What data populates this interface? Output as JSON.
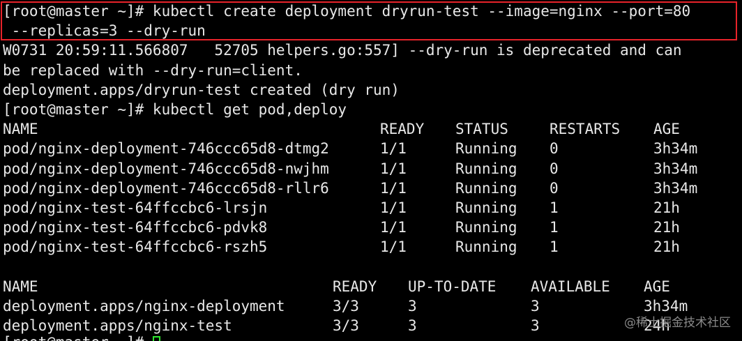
{
  "terminal": {
    "command_line_1": "[root@master ~]# kubectl create deployment dryrun-test --image=nginx --port=80",
    "command_line_2": " --replicas=3 --dry-run",
    "warning_line_1": "W0731 20:59:11.566807   52705 helpers.go:557] --dry-run is deprecated and can",
    "warning_line_2": "be replaced with --dry-run=client.",
    "created_line": "deployment.apps/dryrun-test created (dry run)",
    "get_command": "[root@master ~]# kubectl get pod,deploy",
    "pods_table": {
      "headers": [
        "NAME",
        "READY",
        "STATUS",
        "RESTARTS",
        "AGE"
      ],
      "rows": [
        [
          "pod/nginx-deployment-746ccc65d8-dtmg2",
          "1/1",
          "Running",
          "0",
          "3h34m"
        ],
        [
          "pod/nginx-deployment-746ccc65d8-nwjhm",
          "1/1",
          "Running",
          "0",
          "3h34m"
        ],
        [
          "pod/nginx-deployment-746ccc65d8-rllr6",
          "1/1",
          "Running",
          "0",
          "3h34m"
        ],
        [
          "pod/nginx-test-64ffccbc6-lrsjn",
          "1/1",
          "Running",
          "1",
          "21h"
        ],
        [
          "pod/nginx-test-64ffccbc6-pdvk8",
          "1/1",
          "Running",
          "1",
          "21h"
        ],
        [
          "pod/nginx-test-64ffccbc6-rszh5",
          "1/1",
          "Running",
          "1",
          "21h"
        ]
      ]
    },
    "deploy_table": {
      "headers": [
        "NAME",
        "READY",
        "UP-TO-DATE",
        "AVAILABLE",
        "AGE"
      ],
      "rows": [
        [
          "deployment.apps/nginx-deployment",
          "3/3",
          "3",
          "3",
          "3h34m"
        ],
        [
          "deployment.apps/nginx-test",
          "3/3",
          "3",
          "3",
          "24h"
        ]
      ]
    },
    "final_prompt": "[root@master ~]# ",
    "cursor_color": "#2ee52e",
    "highlight_color": "#e8232a"
  },
  "watermark": "@稀土掘金技术社区"
}
